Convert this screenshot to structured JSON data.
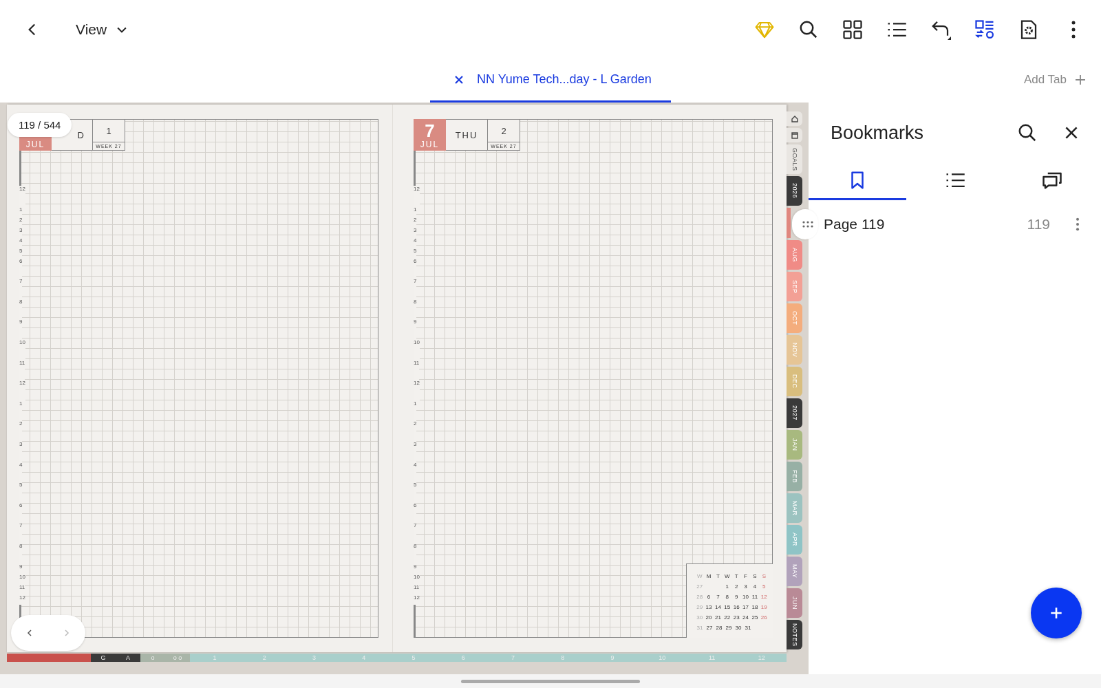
{
  "toolbar": {
    "view_label": "View"
  },
  "tabs": [
    {
      "label": "NN Yume Tech...day - L Garden",
      "selected": true
    }
  ],
  "add_tab": "Add Tab",
  "page_counter": "119 / 544",
  "pages": [
    {
      "month": "JUL",
      "weekday": "D",
      "number": "1",
      "week": "WEEK 27",
      "hours": [
        "12",
        "1",
        "2",
        "3",
        "4",
        "5",
        "6",
        "7",
        "8",
        "9",
        "10",
        "11",
        "12",
        "1",
        "2",
        "3",
        "4",
        "5",
        "6",
        "7",
        "8",
        "9",
        "10",
        "11",
        "12"
      ]
    },
    {
      "day": "7",
      "month": "JUL",
      "weekday": "THU",
      "number": "2",
      "week": "WEEK 27",
      "hours": [
        "12",
        "1",
        "2",
        "3",
        "4",
        "5",
        "6",
        "7",
        "8",
        "9",
        "10",
        "11",
        "12",
        "1",
        "2",
        "3",
        "4",
        "5",
        "6",
        "7",
        "8",
        "9",
        "10",
        "11",
        "12"
      ]
    }
  ],
  "mini_calendar": {
    "headers": [
      "W",
      "M",
      "T",
      "W",
      "T",
      "F",
      "S",
      "S"
    ],
    "rows": [
      {
        "week": "27",
        "days": [
          "1",
          "2",
          "3",
          "4",
          "5"
        ]
      },
      {
        "week": "28",
        "days": [
          "6",
          "7",
          "8",
          "9",
          "10",
          "11",
          "12"
        ]
      },
      {
        "week": "29",
        "days": [
          "13",
          "14",
          "15",
          "16",
          "17",
          "18",
          "19"
        ]
      },
      {
        "week": "30",
        "days": [
          "20",
          "21",
          "22",
          "23",
          "24",
          "25",
          "26"
        ]
      },
      {
        "week": "31",
        "days": [
          "27",
          "28",
          "29",
          "30",
          "31"
        ]
      }
    ]
  },
  "side_tabs": [
    {
      "kind": "home",
      "color": "#e9e6e2"
    },
    {
      "kind": "window",
      "color": "#e9e6e2"
    },
    {
      "kind": "label",
      "label": "GOALS",
      "color": "#e9e6e2"
    },
    {
      "kind": "label",
      "label": "2026",
      "color": "#3a3a3a"
    },
    {
      "kind": "blank",
      "color": "#e0877f"
    },
    {
      "kind": "label",
      "label": "AUG",
      "color": "#f08b86"
    },
    {
      "kind": "label",
      "label": "SEP",
      "color": "#f3a095"
    },
    {
      "kind": "label",
      "label": "OCT",
      "color": "#f4ad7d"
    },
    {
      "kind": "label",
      "label": "NOV",
      "color": "#e6c596"
    },
    {
      "kind": "label",
      "label": "DEC",
      "color": "#d9be7e"
    },
    {
      "kind": "label",
      "label": "2027",
      "color": "#3a3a3a"
    },
    {
      "kind": "label",
      "label": "JAN",
      "color": "#a8b97f"
    },
    {
      "kind": "label",
      "label": "FEB",
      "color": "#97b0a5"
    },
    {
      "kind": "label",
      "label": "MAR",
      "color": "#9cc3c0"
    },
    {
      "kind": "label",
      "label": "APR",
      "color": "#8fc4c6"
    },
    {
      "kind": "label",
      "label": "MAY",
      "color": "#b1a2bb"
    },
    {
      "kind": "label",
      "label": "JUN",
      "color": "#b98a96"
    },
    {
      "kind": "label",
      "label": "NOTES",
      "color": "#3a3a3a"
    }
  ],
  "bottom_strip": [
    {
      "label": "G",
      "color": "#3a3a3a"
    },
    {
      "label": "A",
      "color": "#3a3a3a"
    },
    {
      "label": "o",
      "color": "#a9b5a8"
    },
    {
      "label": "o o",
      "color": "#a9b5a8"
    },
    {
      "label": "1",
      "color": "#a9cfcb"
    },
    {
      "label": "2",
      "color": "#a9cfcb"
    },
    {
      "label": "3",
      "color": "#a9cfcb"
    },
    {
      "label": "4",
      "color": "#a9cfcb"
    },
    {
      "label": "5",
      "color": "#a9cfcb"
    },
    {
      "label": "6",
      "color": "#a9cfcb"
    },
    {
      "label": "7",
      "color": "#a9cfcb"
    },
    {
      "label": "8",
      "color": "#a9cfcb"
    },
    {
      "label": "9",
      "color": "#a9cfcb"
    },
    {
      "label": "10",
      "color": "#a9cfcb"
    },
    {
      "label": "11",
      "color": "#a9cfcb"
    },
    {
      "label": "12",
      "color": "#a9cfcb"
    }
  ],
  "sidebar": {
    "title": "Bookmarks",
    "tabs": [
      {
        "kind": "bookmark",
        "selected": true
      },
      {
        "kind": "list",
        "selected": false
      },
      {
        "kind": "comments",
        "selected": false
      }
    ],
    "bookmarks": [
      {
        "title": "Page 119",
        "page": "119"
      }
    ]
  }
}
